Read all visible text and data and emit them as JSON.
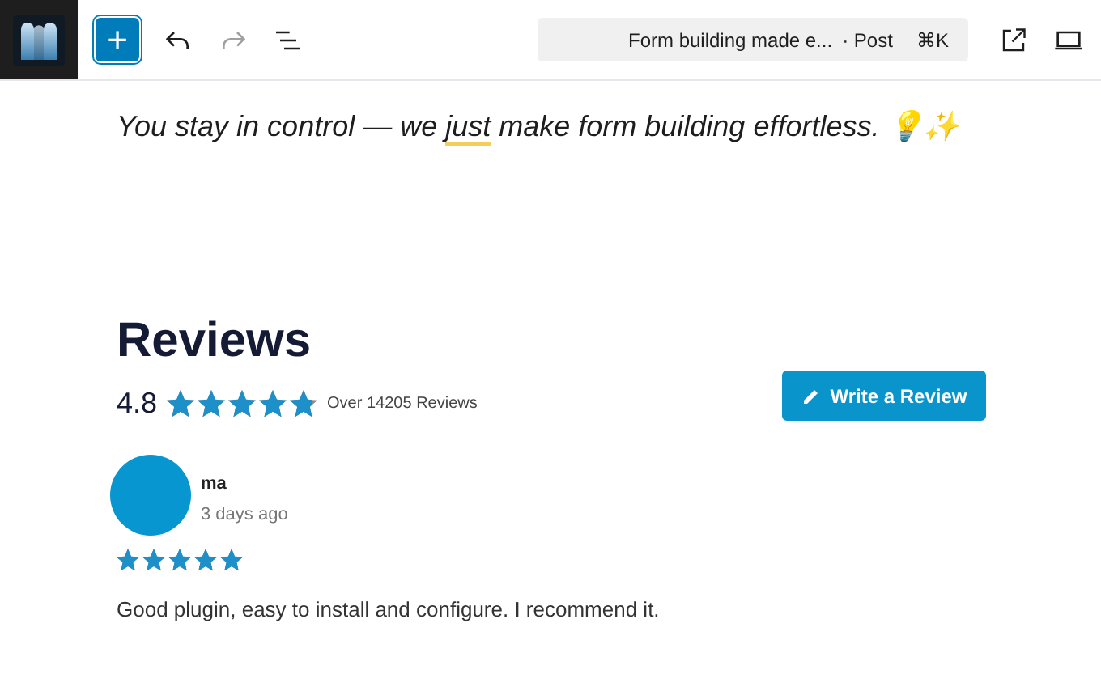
{
  "toolbar": {
    "add_button": {
      "label": "+"
    },
    "undo": {
      "disabled": false
    },
    "redo": {
      "disabled": true
    },
    "command_bar": {
      "title": "Form building made e...",
      "type": "· Post",
      "shortcut": "⌘K"
    }
  },
  "tagline": {
    "before": "You stay in control — we ",
    "highlighted": "just",
    "after": " make form building effortless. 💡✨"
  },
  "reviews": {
    "heading": "Reviews",
    "rating": "4.8",
    "stars": 4.8,
    "count": "Over 14205 Reviews",
    "write_button": "Write a Review",
    "items": [
      {
        "name": "ma",
        "time": "3 days ago",
        "stars": 5,
        "text": "Good plugin, easy to install and configure. I recommend it."
      }
    ]
  }
}
